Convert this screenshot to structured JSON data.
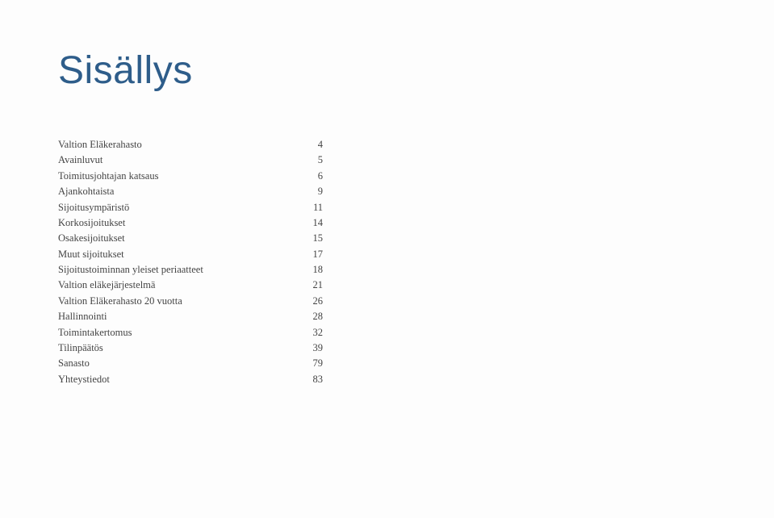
{
  "title": "Sisällys",
  "toc": [
    {
      "label": "Valtion Eläkerahasto",
      "page": "4"
    },
    {
      "label": "Avainluvut",
      "page": "5"
    },
    {
      "label": "Toimitusjohtajan katsaus",
      "page": "6"
    },
    {
      "label": "Ajankohtaista",
      "page": "9"
    },
    {
      "label": "Sijoitusympäristö",
      "page": "11"
    },
    {
      "label": "Korkosijoitukset",
      "page": "14"
    },
    {
      "label": "Osakesijoitukset",
      "page": "15"
    },
    {
      "label": "Muut sijoitukset",
      "page": "17"
    },
    {
      "label": "Sijoitustoiminnan yleiset periaatteet",
      "page": "18"
    },
    {
      "label": "Valtion eläkejärjestelmä",
      "page": "21"
    },
    {
      "label": "Valtion Eläkerahasto 20 vuotta",
      "page": "26"
    },
    {
      "label": "Hallinnointi",
      "page": "28"
    },
    {
      "label": "Toimintakertomus",
      "page": "32"
    },
    {
      "label": "Tilinpäätös",
      "page": "39"
    },
    {
      "label": "Sanasto",
      "page": "79"
    },
    {
      "label": "Yhteystiedot",
      "page": "83"
    }
  ]
}
